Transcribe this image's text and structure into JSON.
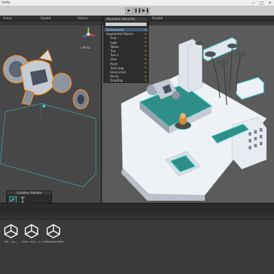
{
  "window": {
    "title": "Unity",
    "min": "—",
    "max": "□",
    "close": "✕"
  },
  "toolbar": {
    "play": "▶",
    "pause": "❚❚",
    "step": "▶❚"
  },
  "scene_view": {
    "tab_label": "Scene",
    "shaded_label": "Shaded",
    "gizmos_label": "Gizmos",
    "persp_label": "< Persp",
    "gizmo_icon": "axis-gizmo-icon"
  },
  "game_view": {
    "tab_label": "Simulation",
    "display_label": "Shaded"
  },
  "hierarchy": {
    "title": "Simulation Hierarchy",
    "search_placeholder": "",
    "items": [
      {
        "label": "Environment",
        "selected": true,
        "level": 0
      },
      {
        "label": "Augmented Objects",
        "selected": false,
        "level": 0
      },
      {
        "label": "Floor",
        "selected": false,
        "level": 1
      },
      {
        "label": "Light",
        "selected": false,
        "level": 1
      },
      {
        "label": "Tables",
        "selected": false,
        "level": 1
      },
      {
        "label": "Tree",
        "selected": false,
        "level": 1
      },
      {
        "label": "Tree 2",
        "selected": false,
        "level": 1
      },
      {
        "label": "Vase",
        "selected": false,
        "level": 1
      },
      {
        "label": "Plant",
        "selected": false,
        "level": 1
      },
      {
        "label": "Trash bag",
        "selected": false,
        "level": 1
      },
      {
        "label": "Glass small",
        "selected": false,
        "level": 1
      },
      {
        "label": "Bench",
        "selected": false,
        "level": 1
      },
      {
        "label": "DropShip",
        "selected": false,
        "level": 1
      }
    ]
  },
  "condition_handles": {
    "title": "Condition Handles"
  },
  "project": {
    "assets": [
      {
        "label": "Ent - cup...",
        "icon": "unity-logo-icon"
      },
      {
        "label": "Aurlo - sour... ss",
        "icon": "unity-logo-icon"
      },
      {
        "label": "EditorSpawnAddin",
        "icon": "unity-logo-icon"
      }
    ]
  },
  "colors": {
    "accent_cyan": "#3fd6d8",
    "selection_orange": "#ff8c1a",
    "floor_teal": "#2f8f88",
    "hierarchy_bg": "#2d2d2d"
  }
}
